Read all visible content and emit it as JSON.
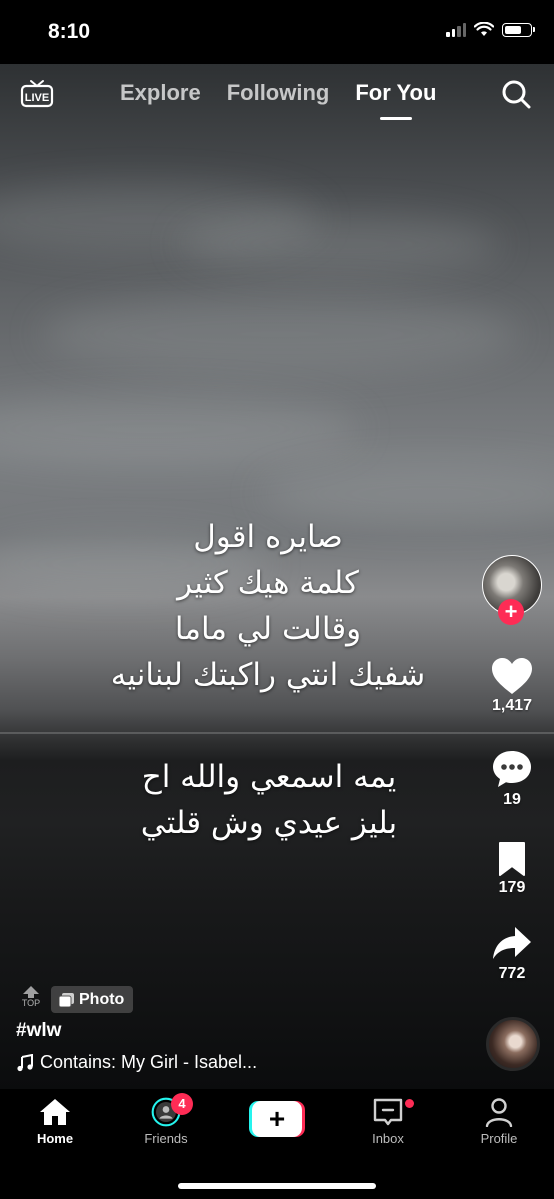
{
  "status_bar": {
    "time": "8:10"
  },
  "top_nav": {
    "live_label": "LIVE",
    "tabs": [
      {
        "label": "Explore",
        "active": false
      },
      {
        "label": "Following",
        "active": false
      },
      {
        "label": "For You",
        "active": true
      }
    ]
  },
  "post": {
    "overlay_lines_1": [
      "صايره اقول",
      "كلمة هيك كثير",
      "وقالت لي ماما",
      "شفيك انتي راكبتك لبنانيه"
    ],
    "overlay_lines_2": [
      "يمه اسمعي والله اح",
      "بليز عيدي وش قلتي"
    ],
    "top_label": "TOP",
    "photo_label": "Photo",
    "caption": "#wlw",
    "music": "Contains: My Girl - Isabel..."
  },
  "actions": {
    "likes": "1,417",
    "comments": "19",
    "saves": "179",
    "shares": "772"
  },
  "tab_bar": {
    "home": "Home",
    "friends": "Friends",
    "friends_badge": "4",
    "inbox": "Inbox",
    "profile": "Profile"
  },
  "colors": {
    "accent": "#fe2c55",
    "cyan": "#25f4ee"
  }
}
